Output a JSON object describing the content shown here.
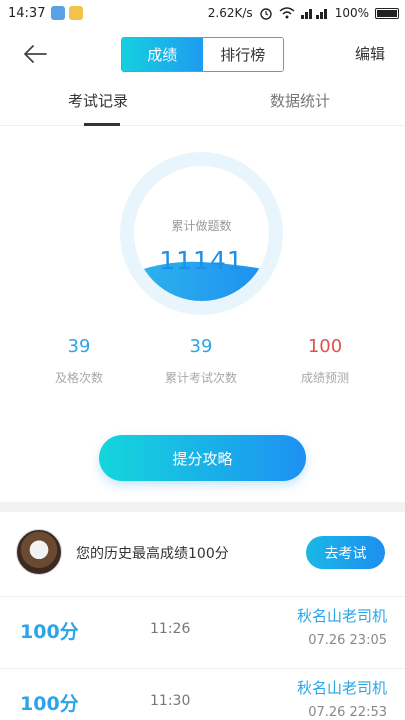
{
  "status_bar": {
    "time": "14:37",
    "speed": "2.62K/s",
    "battery": "100%"
  },
  "nav": {
    "segments": [
      "成绩",
      "排行榜"
    ],
    "edit_label": "编辑"
  },
  "tabs": [
    "考试记录",
    "数据统计"
  ],
  "summary": {
    "circle_label": "累计做题数",
    "total_questions": "11141",
    "stats": [
      {
        "value": "39",
        "label": "及格次数"
      },
      {
        "value": "39",
        "label": "累计考试次数"
      },
      {
        "value": "100",
        "label": "成绩预测"
      }
    ],
    "cta_label": "提分攻略"
  },
  "best": {
    "text": "您的历史最高成绩100分",
    "button_label": "去考试"
  },
  "records": [
    {
      "score": "100分",
      "time": "11:26",
      "name": "秋名山老司机",
      "date": "07.26  23:05"
    },
    {
      "score": "100分",
      "time": "11:30",
      "name": "秋名山老司机",
      "date": "07.26  22:53"
    }
  ],
  "colors": {
    "accent": "#1e9bf0",
    "accent_light": "#15d0e0",
    "prediction": "#e0524f"
  }
}
